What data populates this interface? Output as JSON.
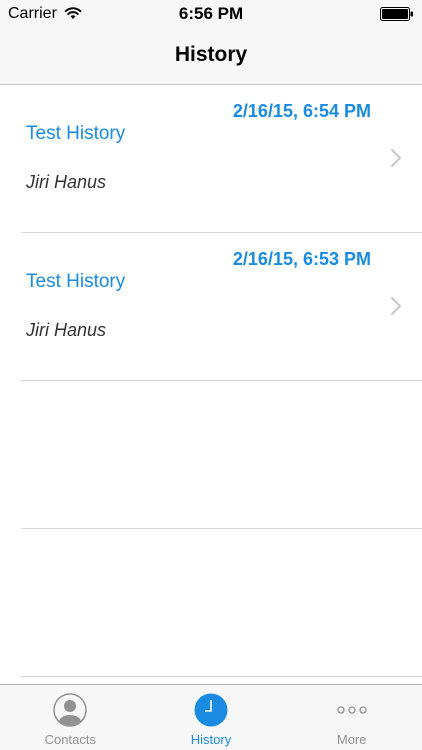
{
  "status_bar": {
    "carrier": "Carrier",
    "time": "6:56 PM",
    "icons": [
      "wifi-icon",
      "battery-icon"
    ]
  },
  "nav": {
    "title": "History"
  },
  "history": {
    "rows": [
      {
        "date": "2/16/15, 6:54 PM",
        "title": "Test History",
        "author": "Jiri Hanus"
      },
      {
        "date": "2/16/15, 6:53 PM",
        "title": "Test History",
        "author": "Jiri Hanus"
      }
    ]
  },
  "tab_bar": {
    "items": [
      {
        "label": "Contacts",
        "icon": "contacts-icon",
        "active": false
      },
      {
        "label": "History",
        "icon": "clock-icon",
        "active": true
      },
      {
        "label": "More",
        "icon": "more-icon",
        "active": false
      }
    ]
  },
  "colors": {
    "accent": "#1a8be0",
    "inactive": "#929292",
    "bar_background": "#f7f7f7",
    "separator": "#d6d6da"
  }
}
